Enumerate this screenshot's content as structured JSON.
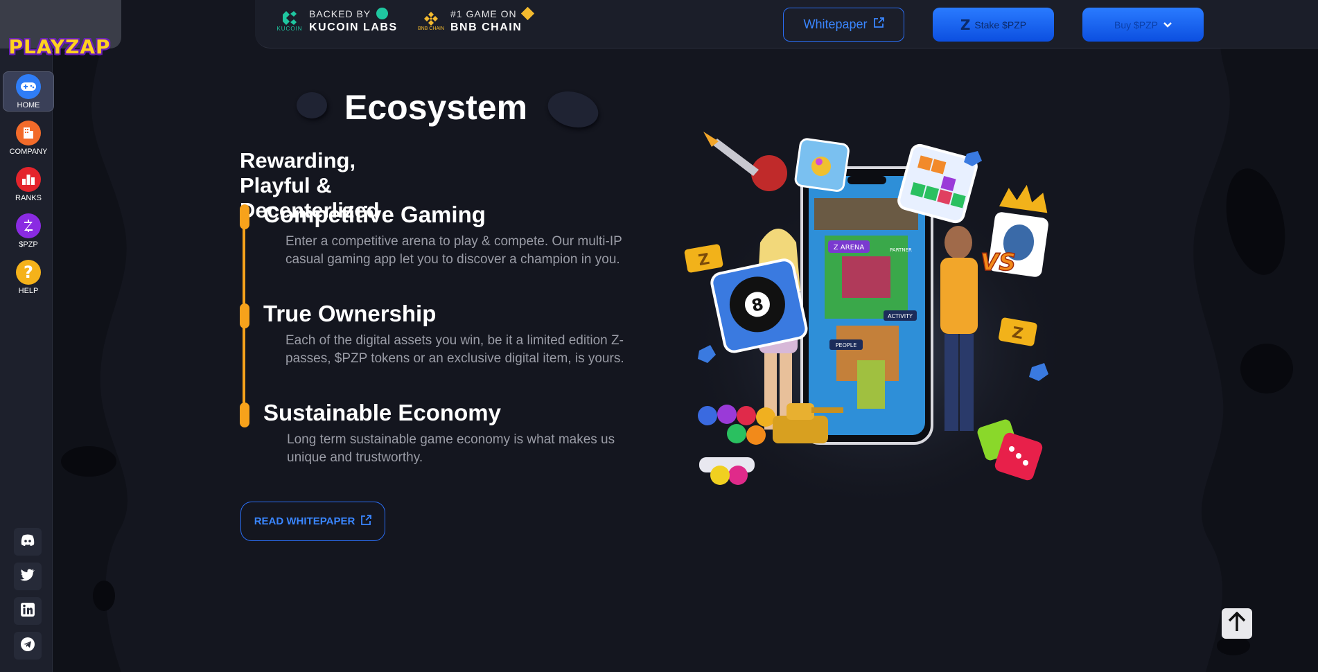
{
  "sidebar": {
    "logo_text": "PLAYZAP",
    "items": [
      {
        "label": "HOME",
        "icon": "gamepad-icon",
        "color": "#2f7df6"
      },
      {
        "label": "COMPANY",
        "icon": "building-icon",
        "color": "#f26b2a"
      },
      {
        "label": "RANKS",
        "icon": "bar-chart-icon",
        "color": "#e4242c"
      },
      {
        "label": "$PZP",
        "icon": "zap-coin-icon",
        "color": "#8a2be2"
      },
      {
        "label": "HELP",
        "icon": "question-icon",
        "color": "#f5b21a"
      }
    ],
    "socials": [
      "discord-icon",
      "twitter-icon",
      "linkedin-icon",
      "telegram-icon"
    ]
  },
  "topbar": {
    "kucoin": {
      "top": "BACKED BY",
      "bottom": "KUCOIN LABS",
      "logo_caption": "KUCOIN"
    },
    "bnb": {
      "top": "#1 GAME ON",
      "bottom": "BNB CHAIN",
      "logo_caption": "BNB CHAIN"
    },
    "whitepaper_label": "Whitepaper",
    "stake_label": "Stake $PZP",
    "buy_label": "Buy $PZP"
  },
  "main": {
    "title": "Ecosystem",
    "subtitle": "Rewarding, Playful & Decenterlized",
    "features": [
      {
        "title": "Competitive Gaming",
        "desc": "Enter a competitive arena to play & compete. Our multi-IP casual gaming app let you to discover a champion in you."
      },
      {
        "title": "True Ownership",
        "desc": "Each of the digital assets you win, be it a limited edition Z-passes, $PZP tokens or an exclusive digital item, is yours."
      },
      {
        "title": "Sustainable Economy",
        "desc": "Long term sustainable game economy is what makes us unique and trustworthy."
      }
    ],
    "read_button": "READ WHITEPAPER"
  },
  "hero": {
    "phone_labels": [
      "Z ARENA",
      "PEOPLE",
      "ACTIVITY",
      "PARTNER"
    ],
    "ball_number": "8",
    "versus": "VS",
    "ticket": "Z"
  },
  "colors": {
    "accent": "#f7a21b",
    "primary_blue": "#2a7bff",
    "background": "#14161f"
  }
}
